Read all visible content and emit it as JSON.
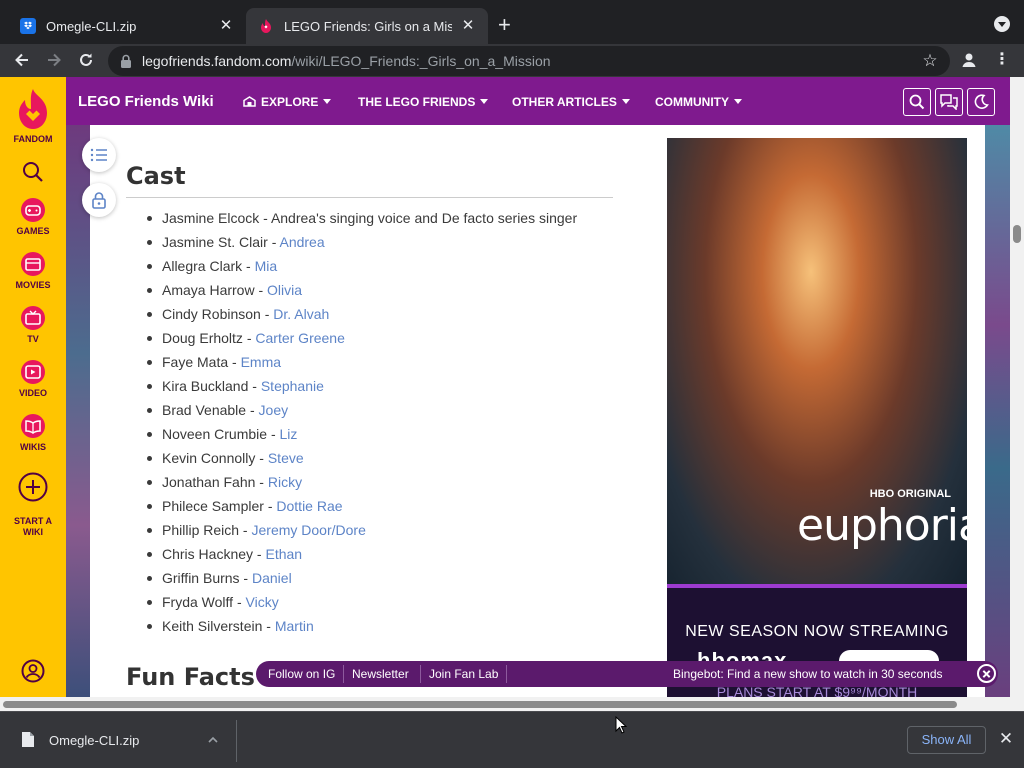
{
  "browser": {
    "tabs": [
      {
        "title": "Omegle-CLI.zip",
        "active": false
      },
      {
        "title": "LEGO Friends: Girls on a Missio",
        "active": true
      }
    ],
    "address": {
      "host": "legofriends.fandom.com",
      "path": "/wiki/LEGO_Friends:_Girls_on_a_Mission"
    },
    "new_tab": "+",
    "close_glyph": "✕"
  },
  "fandom_rail": {
    "logo_label": "FANDOM",
    "items": [
      {
        "label": "GAMES"
      },
      {
        "label": "MOVIES"
      },
      {
        "label": "TV"
      },
      {
        "label": "VIDEO"
      },
      {
        "label": "WIKIS"
      },
      {
        "label": "START A\nWIKI"
      }
    ]
  },
  "wiki_header": {
    "title": "LEGO Friends Wiki",
    "nav": [
      "EXPLORE",
      "THE LEGO FRIENDS",
      "OTHER ARTICLES",
      "COMMUNITY"
    ]
  },
  "article": {
    "section_title": "Cast",
    "cast": [
      {
        "actor": "Jasmine Elcock",
        "role": "Andrea's singing voice and De facto series singer",
        "linked": false
      },
      {
        "actor": "Jasmine St. Clair",
        "role": "Andrea",
        "linked": true
      },
      {
        "actor": "Allegra Clark",
        "role": "Mia",
        "linked": true
      },
      {
        "actor": "Amaya Harrow",
        "role": "Olivia",
        "linked": true
      },
      {
        "actor": "Cindy Robinson",
        "role": "Dr. Alvah",
        "linked": true
      },
      {
        "actor": "Doug Erholtz",
        "role": "Carter Greene",
        "linked": true
      },
      {
        "actor": "Faye Mata",
        "role": "Emma",
        "linked": true
      },
      {
        "actor": "Kira Buckland",
        "role": "Stephanie",
        "linked": true
      },
      {
        "actor": "Brad Venable",
        "role": "Joey",
        "linked": true
      },
      {
        "actor": "Noveen Crumbie",
        "role": "Liz",
        "linked": true
      },
      {
        "actor": "Kevin Connolly",
        "role": "Steve",
        "linked": true
      },
      {
        "actor": "Jonathan Fahn",
        "role": "Ricky",
        "linked": true
      },
      {
        "actor": "Philece Sampler",
        "role": "Dottie Rae",
        "linked": true
      },
      {
        "actor": "Phillip Reich",
        "role": "Jeremy Door/Dore",
        "linked": true
      },
      {
        "actor": "Chris Hackney",
        "role": "Ethan",
        "linked": true
      },
      {
        "actor": "Griffin Burns",
        "role": "Daniel",
        "linked": true
      },
      {
        "actor": "Fryda Wolff",
        "role": "Vicky",
        "linked": true
      },
      {
        "actor": "Keith Silverstein",
        "role": "Martin",
        "linked": true
      }
    ],
    "next_section_title": "Fun Facts",
    "separator": " - "
  },
  "ad": {
    "network": "HBO ORIGINAL",
    "show": "euphoria",
    "streaming_text": "NEW SEASON NOW STREAMING",
    "brand": "hbomax",
    "price_text": "PLANS START AT $9⁹⁹/MONTH"
  },
  "bottom_bar": {
    "links": [
      "Follow on IG",
      "Newsletter",
      "Join Fan Lab"
    ],
    "bot_text": "Bingebot: Find a new show to watch in 30 seconds"
  },
  "download_shelf": {
    "file_name": "Omegle-CLI.zip",
    "show_all": "Show All"
  },
  "colors": {
    "fandom_yellow": "#ffc500",
    "wiki_purple": "#7f1a8e",
    "link_blue": "#5d84c7",
    "chrome_dark": "#202124"
  }
}
